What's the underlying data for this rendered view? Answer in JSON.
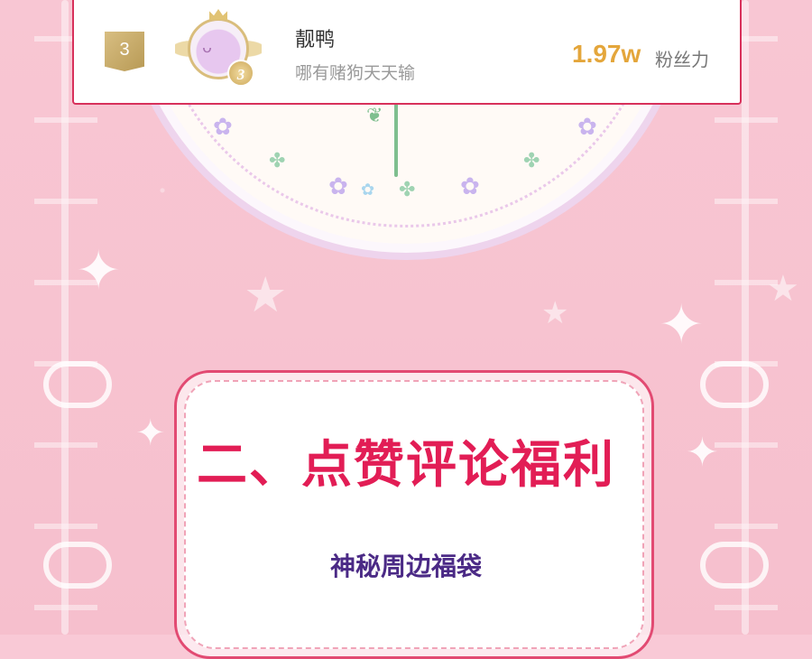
{
  "rank_card": {
    "rank_number": "3",
    "avatar_rank": "3",
    "user_name": "靓鸭",
    "signature": "哪有赌狗天天输",
    "fans_value": "1.97w",
    "fans_label": "粉丝力"
  },
  "section": {
    "title": "二、点赞评论福利",
    "subtitle": "神秘周边福袋"
  },
  "colors": {
    "accent": "#e21d55",
    "fans": "#e4a63b",
    "subtitle": "#4b2a86",
    "background": "#f8c6d3"
  }
}
